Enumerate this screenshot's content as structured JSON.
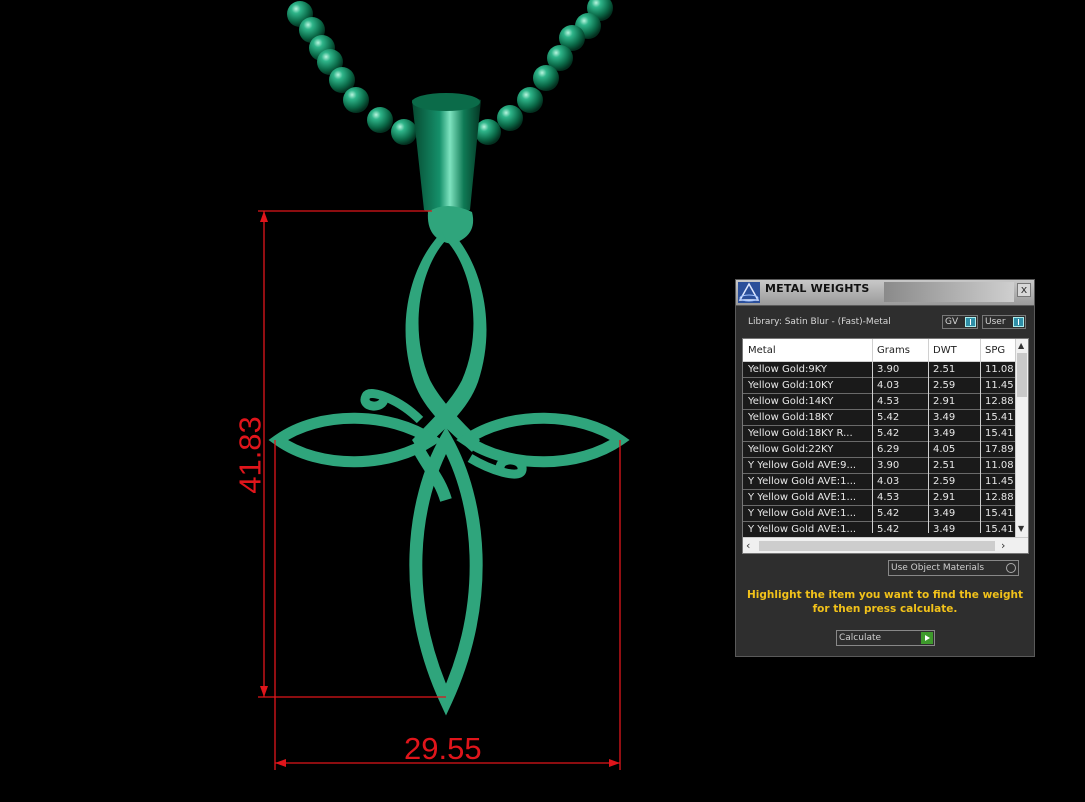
{
  "dimensions": {
    "height_label": "41.83",
    "width_label": "29.55"
  },
  "colors": {
    "dimension_lines": "#e0151b",
    "pendant": "#2fa57c",
    "chain": "#0f7a55",
    "hint_text": "#f2c21a"
  },
  "panel": {
    "title": "METAL WEIGHTS",
    "close_label": "x",
    "library_label": "Library: Satin Blur - (Fast)-Metal",
    "toggle_gv": "GV",
    "toggle_user": "User",
    "columns": [
      "Metal",
      "Grams",
      "DWT",
      "SPG"
    ],
    "rows": [
      {
        "metal": "Yellow Gold:9KY",
        "grams": "3.90",
        "dwt": "2.51",
        "spg": "11.08"
      },
      {
        "metal": "Yellow Gold:10KY",
        "grams": "4.03",
        "dwt": "2.59",
        "spg": "11.45"
      },
      {
        "metal": "Yellow Gold:14KY",
        "grams": "4.53",
        "dwt": "2.91",
        "spg": "12.88"
      },
      {
        "metal": "Yellow Gold:18KY",
        "grams": "5.42",
        "dwt": "3.49",
        "spg": "15.41"
      },
      {
        "metal": "Yellow Gold:18KY R...",
        "grams": "5.42",
        "dwt": "3.49",
        "spg": "15.41"
      },
      {
        "metal": "Yellow Gold:22KY",
        "grams": "6.29",
        "dwt": "4.05",
        "spg": "17.89"
      },
      {
        "metal": "Y Yellow Gold AVE:9...",
        "grams": "3.90",
        "dwt": "2.51",
        "spg": "11.08"
      },
      {
        "metal": "Y Yellow Gold AVE:1...",
        "grams": "4.03",
        "dwt": "2.59",
        "spg": "11.45"
      },
      {
        "metal": "Y Yellow Gold AVE:1...",
        "grams": "4.53",
        "dwt": "2.91",
        "spg": "12.88"
      },
      {
        "metal": "Y Yellow Gold AVE:1...",
        "grams": "5.42",
        "dwt": "3.49",
        "spg": "15.41"
      },
      {
        "metal": "Y Yellow Gold AVE:1...",
        "grams": "5.42",
        "dwt": "3.49",
        "spg": "15.41"
      }
    ],
    "use_object_materials": "Use Object Materials",
    "hint_line1": "Highlight the item you want to find the weight",
    "hint_line2": "for then press calculate.",
    "calculate_label": "Calculate"
  }
}
